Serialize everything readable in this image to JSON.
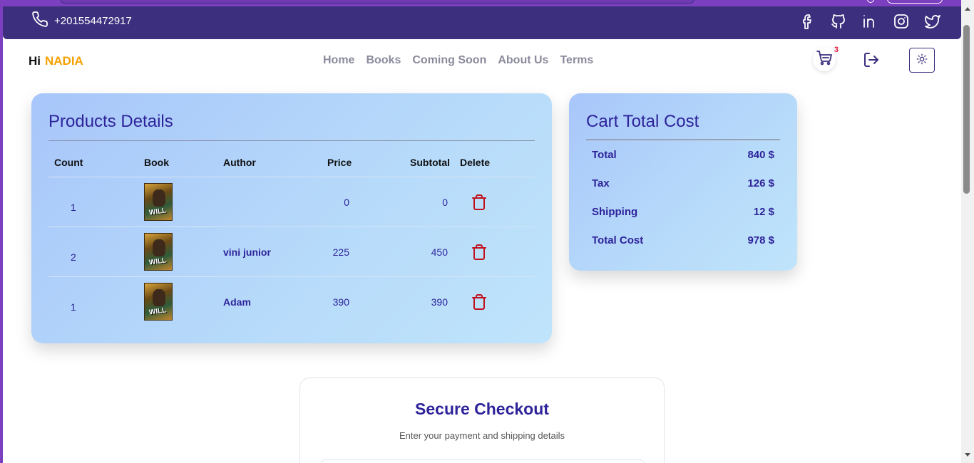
{
  "contact": {
    "phone": "+201554472917"
  },
  "socials": [
    "facebook-icon",
    "github-icon",
    "linkedin-icon",
    "instagram-icon",
    "twitter-icon"
  ],
  "nav": {
    "greeting": "Hi",
    "username": "NADIA",
    "links": [
      "Home",
      "Books",
      "Coming Soon",
      "About Us",
      "Terms"
    ],
    "cart_count": "3"
  },
  "products": {
    "title": "Products Details",
    "headers": {
      "count": "Count",
      "book": "Book",
      "author": "Author",
      "price": "Price",
      "subtotal": "Subtotal",
      "delete": "Delete"
    },
    "rows": [
      {
        "count": "1",
        "author": "",
        "price": "0",
        "subtotal": "0"
      },
      {
        "count": "2",
        "author": "vini junior",
        "price": "225",
        "subtotal": "450"
      },
      {
        "count": "1",
        "author": "Adam",
        "price": "390",
        "subtotal": "390"
      }
    ],
    "cover_text": "WILL"
  },
  "totals": {
    "title": "Cart Total Cost",
    "rows": [
      {
        "label": "Total",
        "value": "840 $"
      },
      {
        "label": "Tax",
        "value": "126 $"
      },
      {
        "label": "Shipping",
        "value": "12 $"
      },
      {
        "label": "Total Cost",
        "value": "978 $"
      }
    ]
  },
  "checkout": {
    "title": "Secure Checkout",
    "subtitle": "Enter your payment and shipping details"
  },
  "colors": {
    "brand": "#3b2f7e",
    "accent": "#f5a000",
    "heading": "#2e239a",
    "danger": "#c0101d"
  }
}
